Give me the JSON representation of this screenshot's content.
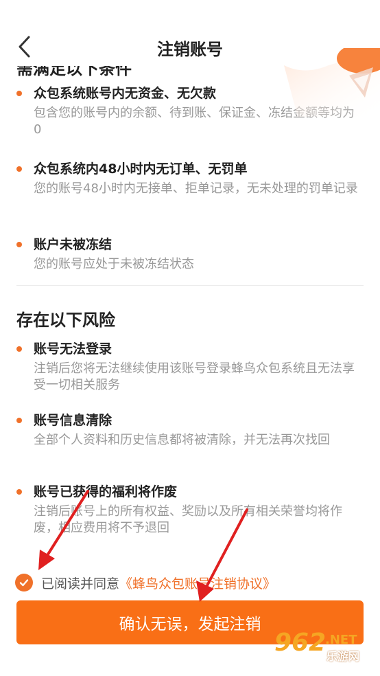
{
  "header": {
    "title": "注销账号"
  },
  "conditions": {
    "cutoff_heading": "需满足以下条件",
    "items": [
      {
        "title": "众包系统账号内无资金、无欠款",
        "desc": "包含您的账号内的余额、待到账、保证金、冻结金额等均为0"
      },
      {
        "title": "众包系统内48小时内无订单、无罚单",
        "desc": "您的账号48小时内无接单、拒单记录，无未处理的罚单记录"
      },
      {
        "title": "账户未被冻结",
        "desc": "您的账号应处于未被冻结状态"
      }
    ]
  },
  "risks": {
    "title": "存在以下风险",
    "items": [
      {
        "title": "账号无法登录",
        "desc": "注销后您将无法继续使用该账号登录蜂鸟众包系统且无法享受一切相关服务"
      },
      {
        "title": "账号信息清除",
        "desc": "全部个人资料和历史信息都将被清除，并无法再次找回"
      },
      {
        "title": "账号已获得的福利将作废",
        "desc": "注销后账号上的所有权益、奖励以及所有相关荣誉均将作废，相应费用将不予退回"
      }
    ]
  },
  "agreement": {
    "checked": true,
    "text": "已阅读并同意",
    "link": "《蜂鸟众包账号注销协议》"
  },
  "confirm_button": {
    "label": "确认无误，发起注销"
  },
  "watermark": {
    "number": "962",
    "suffix": ".NET",
    "site": "乐游网"
  },
  "colors": {
    "accent": "#f96f16",
    "bullet": "#f0712a",
    "annotation_arrow": "#e02020"
  },
  "icons": {
    "back": "chevron-left-icon",
    "check": "check-icon",
    "decoration": "shield-decoration-icon"
  }
}
